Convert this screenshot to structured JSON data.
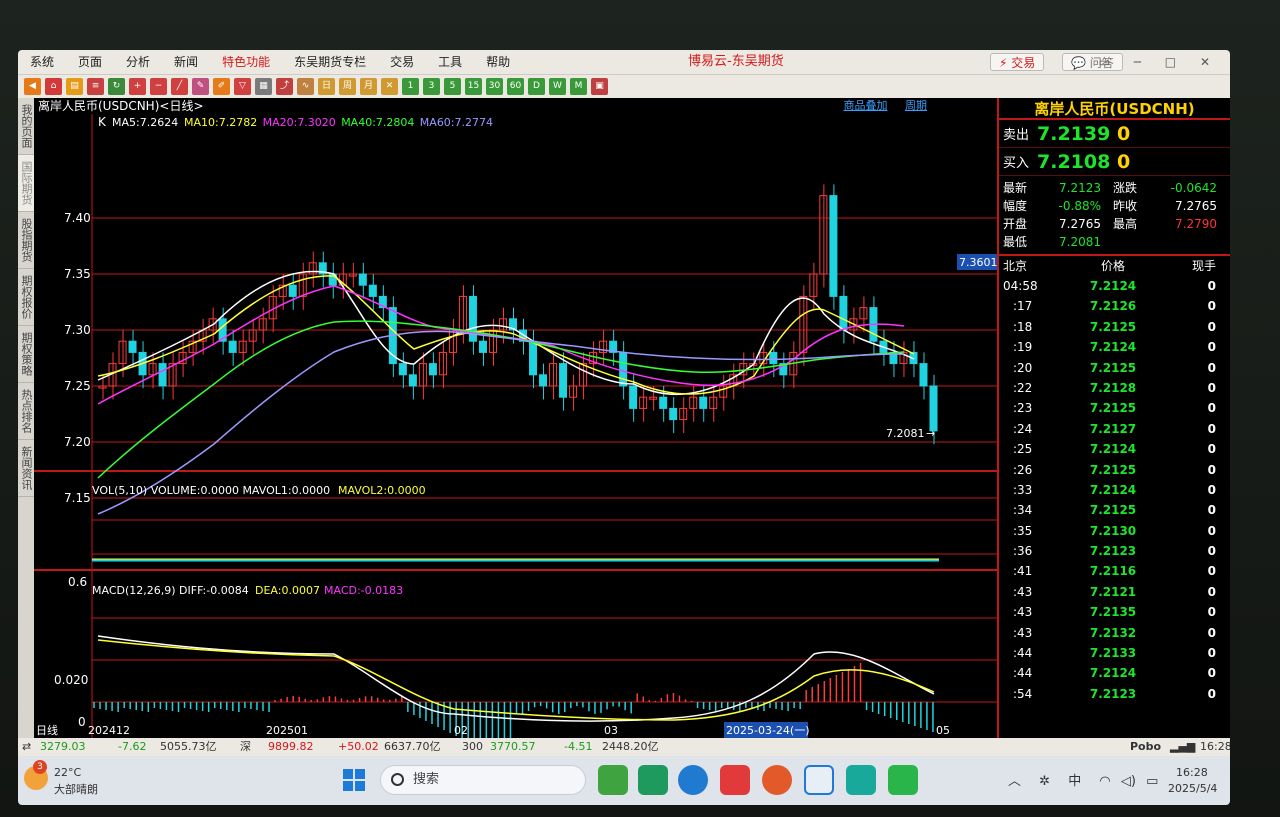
{
  "menubar": {
    "items": [
      "系统",
      "页面",
      "分析",
      "新闻",
      "特色功能",
      "东吴期货专栏",
      "交易",
      "工具",
      "帮助"
    ],
    "highlight_index": 4,
    "app_title": "博易云-东吴期货",
    "trade_button": "交易",
    "qa_button": "问答"
  },
  "sidenav": {
    "items": [
      "我的页面",
      "国际期货",
      "股指期货",
      "期权报价",
      "期权策略",
      "热点排名",
      "新闻资讯"
    ],
    "active_index": 1
  },
  "chart": {
    "title": "离岸人民币(USDCNH)<日线>",
    "links": [
      "商品叠加",
      "周期"
    ],
    "ma_legend": [
      {
        "text": "MA5:7.2624",
        "color": "#ffffff"
      },
      {
        "text": "MA10:7.2782",
        "color": "#ffff33"
      },
      {
        "text": "MA20:7.3020",
        "color": "#ff33ff"
      },
      {
        "text": "MA40:7.2804",
        "color": "#33ff33"
      },
      {
        "text": "MA60:7.2774",
        "color": "#9999ff"
      }
    ],
    "k_label": "K",
    "price_ticks": [
      "7.40",
      "7.35",
      "7.30",
      "7.25",
      "7.20",
      "7.15"
    ],
    "high_tag": "7.3601",
    "low_tag": "7.2081",
    "vol_legend": {
      "prefix": "VOL(5,10) VOLUME:0.0000 MAVOL1:0.0000",
      "mavol2": "MAVOL2:0.0000"
    },
    "vol_tick": "0.6",
    "macd_legend": {
      "prefix": "MACD(12,26,9) DIFF:-0.0084",
      "dea": "DEA:0.0007",
      "macd": "MACD:-0.0183"
    },
    "macd_ticks": [
      "0.020",
      "0"
    ],
    "x_labels": [
      "日线",
      "202412",
      "202501",
      "02",
      "03",
      "05"
    ],
    "x_cursor": "2025-03-24(一)"
  },
  "quote": {
    "title": "离岸人民币(USDCNH)",
    "sell_label": "卖出",
    "sell_price": "7.2139",
    "sell_vol": "0",
    "buy_label": "买入",
    "buy_price": "7.2108",
    "buy_vol": "0",
    "stats": [
      {
        "l": "最新",
        "v": "7.2123",
        "vc": "#1ee52b",
        "l2": "涨跌",
        "v2": "-0.0642",
        "v2c": "#1ee52b"
      },
      {
        "l": "幅度",
        "v": "-0.88%",
        "vc": "#1ee52b",
        "l2": "昨收",
        "v2": "7.2765",
        "v2c": "#ffffff"
      },
      {
        "l": "开盘",
        "v": "7.2765",
        "vc": "#ffffff",
        "l2": "最高",
        "v2": "7.2790",
        "v2c": "#ff3333"
      },
      {
        "l": "最低",
        "v": "7.2081",
        "vc": "#1ee52b",
        "l2": "",
        "v2": "",
        "v2c": "#ffffff"
      }
    ],
    "ticks_header": [
      "北京",
      "价格",
      "现手"
    ],
    "ticks": [
      [
        "04:58",
        "7.2124",
        "0"
      ],
      [
        ":17",
        "7.2126",
        "0"
      ],
      [
        ":18",
        "7.2125",
        "0"
      ],
      [
        ":19",
        "7.2124",
        "0"
      ],
      [
        ":20",
        "7.2125",
        "0"
      ],
      [
        ":22",
        "7.2128",
        "0"
      ],
      [
        ":23",
        "7.2125",
        "0"
      ],
      [
        ":24",
        "7.2127",
        "0"
      ],
      [
        ":25",
        "7.2124",
        "0"
      ],
      [
        ":26",
        "7.2125",
        "0"
      ],
      [
        ":33",
        "7.2124",
        "0"
      ],
      [
        ":34",
        "7.2125",
        "0"
      ],
      [
        ":35",
        "7.2130",
        "0"
      ],
      [
        ":36",
        "7.2123",
        "0"
      ],
      [
        ":41",
        "7.2116",
        "0"
      ],
      [
        ":43",
        "7.2121",
        "0"
      ],
      [
        ":43",
        "7.2135",
        "0"
      ],
      [
        ":43",
        "7.2132",
        "0"
      ],
      [
        ":44",
        "7.2133",
        "0"
      ],
      [
        ":44",
        "7.2124",
        "0"
      ],
      [
        ":54",
        "7.2123",
        "0"
      ]
    ]
  },
  "statusbar": {
    "a": "3279.03",
    "a_chg": "-7.62",
    "a_amt": "5055.73亿",
    "b_name": "深",
    "b": "9899.82",
    "b_chg": "+50.02",
    "b_amt": "6637.70亿",
    "c_name": "300",
    "c": "3770.57",
    "c_chg": "-4.51",
    "c_amt": "2448.20亿",
    "brand": "Pobo",
    "time": "16:28"
  },
  "taskbar": {
    "temp": "22°C",
    "weather": "大部晴朗",
    "badge": "3",
    "search": "搜索",
    "ime": "中",
    "time": "16:28",
    "date": "2025/5/4"
  }
}
